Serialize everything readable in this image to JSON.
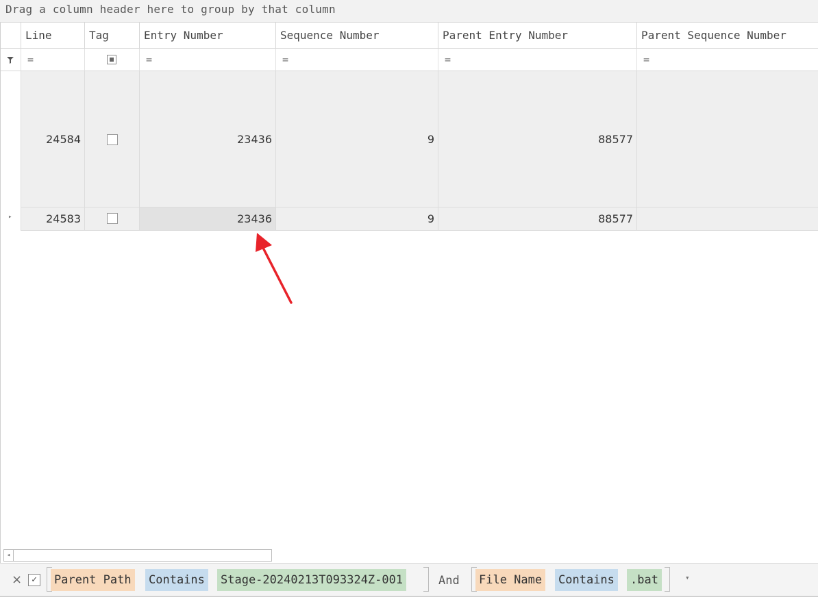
{
  "group_panel": {
    "hint": "Drag a column header here to group by that column"
  },
  "columns": [
    "Line",
    "Tag",
    "Entry Number",
    "Sequence Number",
    "Parent Entry Number",
    "Parent Sequence Number"
  ],
  "filter_row": {
    "operator_symbol": "=",
    "filter_icon": "funnel-icon"
  },
  "rows": [
    {
      "line": "24584",
      "tag": false,
      "entry_number": "23436",
      "sequence_number": "9",
      "parent_entry_number": "88577",
      "parent_sequence_number": ""
    },
    {
      "line": "24583",
      "tag": false,
      "entry_number": "23436",
      "sequence_number": "9",
      "parent_entry_number": "88577",
      "parent_sequence_number": ""
    }
  ],
  "annotation": {
    "type": "red-arrow",
    "target": "rows.1.entry_number",
    "color": "#e8232a"
  },
  "filter_bar": {
    "close_symbol": "×",
    "enabled_symbol": "✓",
    "condition1": {
      "field": "Parent Path",
      "operator": "Contains",
      "value": "Stage-20240213T093324Z-001"
    },
    "conjunction": "And",
    "condition2": {
      "field": "File Name",
      "operator": "Contains",
      "value": ".bat"
    },
    "dropdown_symbol": "▾"
  },
  "scrollbar": {
    "left_arrow": "◂"
  },
  "colors": {
    "field_token": "#f8d9bb",
    "operator_token": "#c6dcee",
    "value_token": "#c5e0c5",
    "row_bg": "#efefef",
    "focused_cell": "#e2e2e2"
  }
}
